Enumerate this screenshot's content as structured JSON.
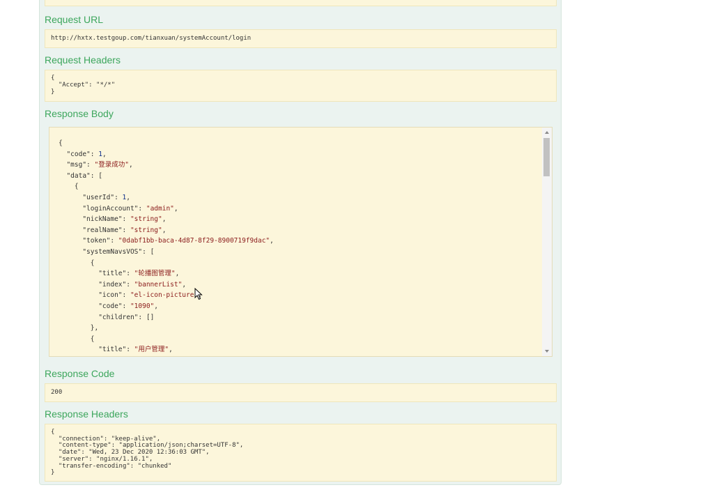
{
  "top_cut_text": "                                                                                                                    ",
  "request_url": {
    "title": "Request URL",
    "value": "http://hxtx.testgoup.com/tianxuan/systemAccount/login"
  },
  "request_headers": {
    "title": "Request Headers",
    "value": "{\n  \"Accept\": \"*/*\"\n}"
  },
  "response_body": {
    "title": "Response Body",
    "lines": [
      "{",
      "  \"code\": 1,",
      "  \"msg\": \"登录成功\",",
      "  \"data\": [",
      "    {",
      "      \"userId\": 1,",
      "      \"loginAccount\": \"admin\",",
      "      \"nickName\": \"string\",",
      "      \"realName\": \"string\",",
      "      \"token\": \"0dabf1bb-baca-4d87-8f29-8900719f9dac\",",
      "      \"systemNavsVOS\": [",
      "        {",
      "          \"title\": \"轮播图管理\",",
      "          \"index\": \"bannerList\",",
      "          \"icon\": \"el-icon-picture\",",
      "          \"code\": \"1090\",",
      "          \"children\": []",
      "        },",
      "        {",
      "          \"title\": \"用户管理\","
    ]
  },
  "response_code": {
    "title": "Response Code",
    "value": "200"
  },
  "response_headers": {
    "title": "Response Headers",
    "value": "{\n  \"connection\": \"keep-alive\",\n  \"content-type\": \"application/json;charset=UTF-8\",\n  \"date\": \"Wed, 23 Dec 2020 12:36:03 GMT\",\n  \"server\": \"nginx/1.16.1\",\n  \"transfer-encoding\": \"chunked\"\n}"
  },
  "colors": {
    "section_title": "#3ca65c",
    "panel_bg": "#ebf3f0",
    "code_bg": "#fcf6db",
    "string": "#8a1a1a",
    "number": "#0b2d8a"
  }
}
